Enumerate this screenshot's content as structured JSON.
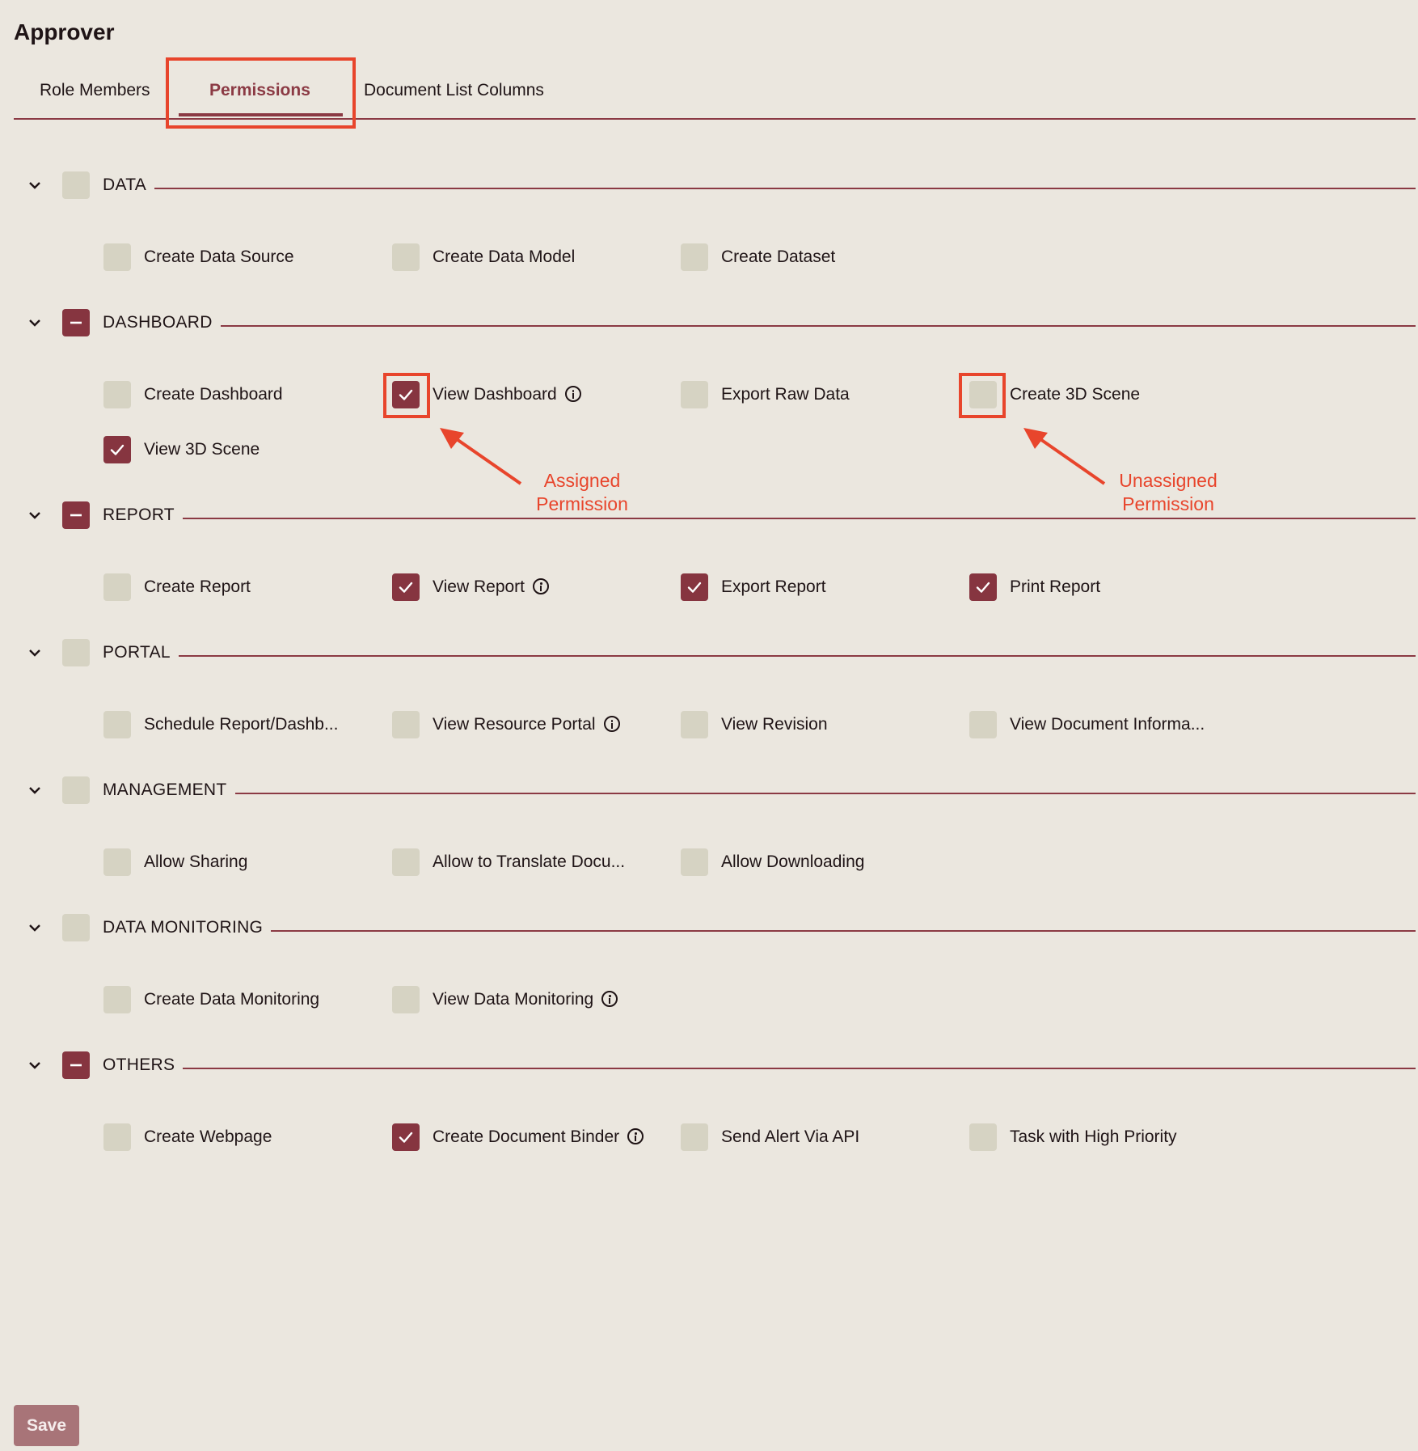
{
  "page": {
    "title": "Approver"
  },
  "tabs": [
    {
      "label": "Role Members",
      "active": false
    },
    {
      "label": "Permissions",
      "active": true
    },
    {
      "label": "Document List Columns",
      "active": false
    }
  ],
  "colors": {
    "accent": "#8b3a44",
    "checkbox_checked": "#863540",
    "checkbox_unchecked": "#d6d3c3",
    "annotation": "#e8452c",
    "background": "#ebe7df"
  },
  "sections": [
    {
      "label": "DATA",
      "state": "unchecked",
      "items": [
        {
          "label": "Create Data Source",
          "checked": false,
          "info": false
        },
        {
          "label": "Create Data Model",
          "checked": false,
          "info": false
        },
        {
          "label": "Create Dataset",
          "checked": false,
          "info": false
        }
      ]
    },
    {
      "label": "DASHBOARD",
      "state": "partial",
      "items": [
        {
          "label": "Create Dashboard",
          "checked": false,
          "info": false
        },
        {
          "label": "View Dashboard",
          "checked": true,
          "info": true
        },
        {
          "label": "Export Raw Data",
          "checked": false,
          "info": false
        },
        {
          "label": "Create 3D Scene",
          "checked": false,
          "info": false
        },
        {
          "label": "View 3D Scene",
          "checked": true,
          "info": false
        }
      ]
    },
    {
      "label": "REPORT",
      "state": "partial",
      "items": [
        {
          "label": "Create Report",
          "checked": false,
          "info": false
        },
        {
          "label": "View Report",
          "checked": true,
          "info": true
        },
        {
          "label": "Export Report",
          "checked": true,
          "info": false
        },
        {
          "label": "Print Report",
          "checked": true,
          "info": false
        }
      ]
    },
    {
      "label": "PORTAL",
      "state": "unchecked",
      "items": [
        {
          "label": "Schedule Report/Dashb...",
          "checked": false,
          "info": false
        },
        {
          "label": "View Resource Portal",
          "checked": false,
          "info": true
        },
        {
          "label": "View Revision",
          "checked": false,
          "info": false
        },
        {
          "label": "View Document Informa...",
          "checked": false,
          "info": false
        }
      ]
    },
    {
      "label": "MANAGEMENT",
      "state": "unchecked",
      "items": [
        {
          "label": "Allow Sharing",
          "checked": false,
          "info": false
        },
        {
          "label": "Allow to Translate Docu...",
          "checked": false,
          "info": false
        },
        {
          "label": "Allow Downloading",
          "checked": false,
          "info": false
        }
      ]
    },
    {
      "label": "DATA MONITORING",
      "state": "unchecked",
      "items": [
        {
          "label": "Create Data Monitoring",
          "checked": false,
          "info": false
        },
        {
          "label": "View Data Monitoring",
          "checked": false,
          "info": true
        }
      ]
    },
    {
      "label": "OTHERS",
      "state": "partial",
      "items": [
        {
          "label": "Create Webpage",
          "checked": false,
          "info": false
        },
        {
          "label": "Create Document Binder",
          "checked": true,
          "info": true
        },
        {
          "label": "Send Alert Via API",
          "checked": false,
          "info": false
        },
        {
          "label": "Task with High Priority",
          "checked": false,
          "info": false
        }
      ]
    }
  ],
  "annotations": {
    "assigned": "Assigned\nPermission",
    "unassigned": "Unassigned\nPermission"
  },
  "footer": {
    "save_label": "Save"
  }
}
